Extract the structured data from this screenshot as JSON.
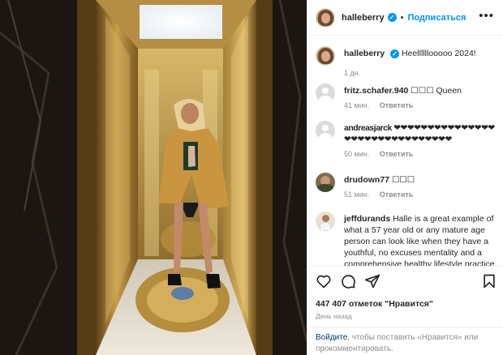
{
  "header": {
    "username": "halleberry",
    "separator": "•",
    "follow_label": "Подписаться",
    "more_icon": "more-horizontal-icon",
    "more_glyph": "•••"
  },
  "caption": {
    "username": "halleberry",
    "text": "Heellllllooooo 2024!",
    "time": "1 дн."
  },
  "comments": [
    {
      "username": "fritz.schafer.940",
      "text": "\u0000\u0000\u0000 Queen",
      "display_text": "☐☐☐ Queen",
      "time": "41 мин.",
      "reply": "Ответить"
    },
    {
      "username": "andreasjarck",
      "text": "❤❤❤❤❤❤❤❤❤❤❤❤❤❤❤❤❤❤❤❤❤❤❤❤❤❤❤❤❤❤❤",
      "time": "50 мин.",
      "reply": "Ответить"
    },
    {
      "username": "drudown77",
      "text": "☐☐☐",
      "time": "51 мин.",
      "reply": "Ответить"
    },
    {
      "username": "jeffdurands",
      "text": "Halle is a great example of what a 57 year old or any mature age person can look like when they have a youthful, no excuses mentality and a comprehensive healthy lifestyle practice"
    }
  ],
  "actions": {
    "like_icon": "heart-icon",
    "comment_icon": "comment-icon",
    "share_icon": "share-icon",
    "save_icon": "bookmark-icon",
    "likes": "447 407 отметок \"Нравится\"",
    "date": "День назад"
  },
  "login": {
    "link": "Войдите",
    "text": ", чтобы поставить «Нравится» или прокомментировать."
  },
  "colors": {
    "accent": "#0095f6",
    "link_dark": "#00376b",
    "muted": "#8e8e8e"
  }
}
